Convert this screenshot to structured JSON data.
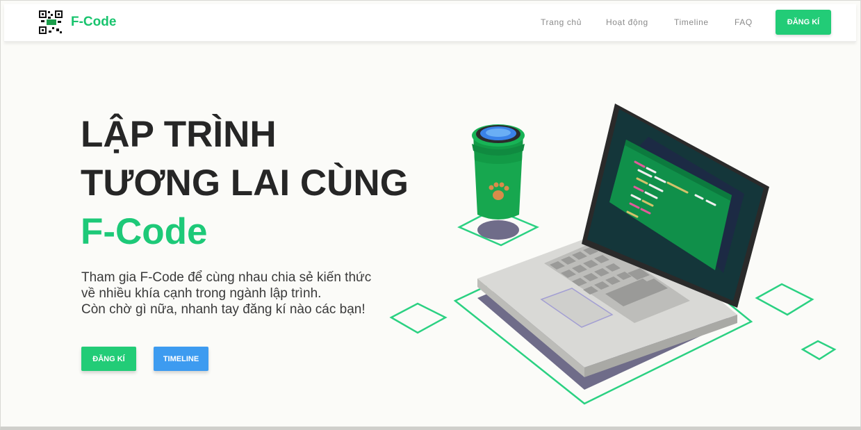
{
  "header": {
    "brand": "F-Code",
    "nav": [
      "Trang chủ",
      "Hoạt động",
      "Timeline",
      "FAQ"
    ],
    "signup_label": "ĐĂNG KÍ"
  },
  "hero": {
    "title_line1": "LẬP TRÌNH",
    "title_line2": "TƯƠNG LAI CÙNG",
    "title_accent": "F-Code",
    "desc_line1": "Tham gia F-Code để cùng nhau chia sẻ kiến thức",
    "desc_line2": "về nhiều khía cạnh trong ngành lập trình.",
    "desc_line3": "Còn chờ gì nữa, nhanh tay đăng kí nào các bạn!",
    "signup_label": "ĐĂNG KÍ",
    "timeline_label": "TIMELINE"
  },
  "colors": {
    "brand": "#1dc978",
    "primary_button": "#22cc77",
    "secondary_button": "#3d9bf0",
    "heading": "#262626"
  },
  "icons": [
    "qr-logo-icon",
    "paw-icon",
    "laptop-illustration",
    "cup-illustration"
  ]
}
